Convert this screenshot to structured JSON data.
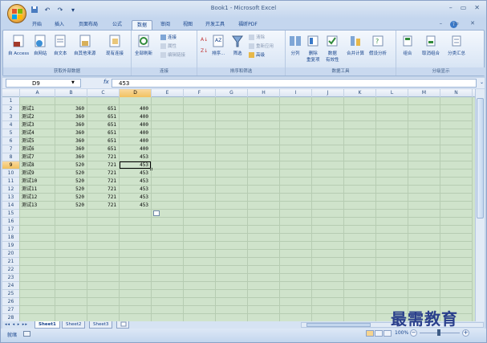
{
  "title": "Book1 - Microsoft Excel",
  "qat": {
    "save_icon": "save-icon",
    "undo": "↶",
    "redo": "↷",
    "qat_more": "▾"
  },
  "window_controls": {
    "minimize": "–",
    "restore": "▭",
    "close": "✕"
  },
  "mdi_controls": "– ▭ ✕",
  "tabs": [
    "开始",
    "插入",
    "页面布局",
    "公式",
    "数据",
    "审阅",
    "视图",
    "开发工具",
    "福昕PDF"
  ],
  "active_tab": "数据",
  "ribbon": {
    "get_external": {
      "label": "获取外部数据",
      "items": [
        "自 Access",
        "自网站",
        "自文本",
        "自其他来源",
        "现有连接"
      ]
    },
    "connections": {
      "label": "连接",
      "refresh": "全部刷新",
      "links": [
        "连接",
        "属性",
        "编辑链接"
      ]
    },
    "sort_filter": {
      "label": "排序和筛选",
      "sort": "排序...",
      "filter": "筛选",
      "links": [
        "清除",
        "重新应用",
        "高级"
      ]
    },
    "data_tools": {
      "label": "数据工具",
      "items": [
        "分列",
        "删除\n重复项",
        "数据\n有效性",
        "合并计算",
        "假设分析"
      ]
    },
    "outline": {
      "label": "分级显示",
      "items": [
        "组合",
        "取消组合",
        "分类汇总"
      ]
    }
  },
  "formula_bar": {
    "name_box": "D9",
    "fx": "fx",
    "value": "453"
  },
  "columns": [
    "A",
    "B",
    "C",
    "D",
    "E",
    "F",
    "G",
    "H",
    "I",
    "J",
    "K",
    "L",
    "M",
    "N"
  ],
  "selected_column": "D",
  "selected_row": "9",
  "rows": [
    "1",
    "2",
    "3",
    "4",
    "5",
    "6",
    "7",
    "8",
    "9",
    "10",
    "11",
    "12",
    "13",
    "14",
    "15",
    "16",
    "17",
    "18",
    "19",
    "20",
    "21",
    "22",
    "23",
    "24",
    "25",
    "26",
    "27",
    "28"
  ],
  "data": [
    [
      "测试1",
      "360",
      "651",
      "400"
    ],
    [
      "测试2",
      "360",
      "651",
      "400"
    ],
    [
      "测试3",
      "360",
      "651",
      "400"
    ],
    [
      "测试4",
      "360",
      "651",
      "400"
    ],
    [
      "测试5",
      "360",
      "651",
      "400"
    ],
    [
      "测试6",
      "360",
      "651",
      "400"
    ],
    [
      "测试7",
      "360",
      "721",
      "453"
    ],
    [
      "测试8",
      "520",
      "721",
      "453"
    ],
    [
      "测试9",
      "520",
      "721",
      "453"
    ],
    [
      "测试10",
      "520",
      "721",
      "453"
    ],
    [
      "测试11",
      "520",
      "721",
      "453"
    ],
    [
      "测试12",
      "520",
      "721",
      "453"
    ],
    [
      "测试13",
      "520",
      "721",
      "453"
    ]
  ],
  "sheet_tabs": [
    "Sheet1",
    "Sheet2",
    "Sheet3"
  ],
  "active_sheet": "Sheet1",
  "nav_buttons": "◂◂ ◂ ▸ ▸▸",
  "status": {
    "ready": "就绪",
    "zoom": "100%"
  },
  "watermark": "最需教育",
  "colors": {
    "grid_bg": "#cfe3cb",
    "accent": "#15428b",
    "selected_header": "#f1c15f"
  }
}
